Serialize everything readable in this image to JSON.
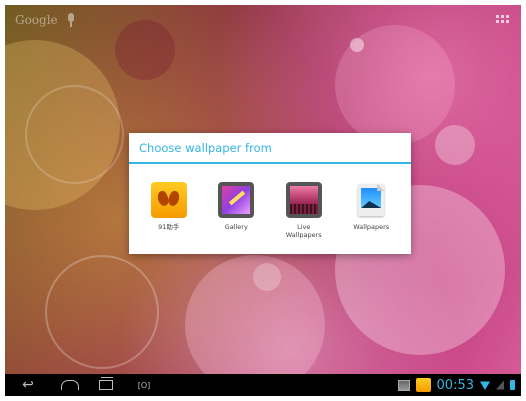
{
  "homescreen": {
    "search_label": "Google"
  },
  "dialog": {
    "title": "Choose wallpaper from",
    "options": [
      {
        "label": "91助手",
        "icon": "91-assistant-icon"
      },
      {
        "label": "Gallery",
        "icon": "gallery-icon"
      },
      {
        "label": "Live\nWallpapers",
        "icon": "live-wallpapers-icon"
      },
      {
        "label": "Wallpapers",
        "icon": "wallpapers-icon"
      }
    ]
  },
  "navbar": {
    "screenshot_label": "[O]"
  },
  "status": {
    "time": "00:53"
  },
  "colors": {
    "accent": "#33b5e5",
    "navbar": "#000000"
  }
}
